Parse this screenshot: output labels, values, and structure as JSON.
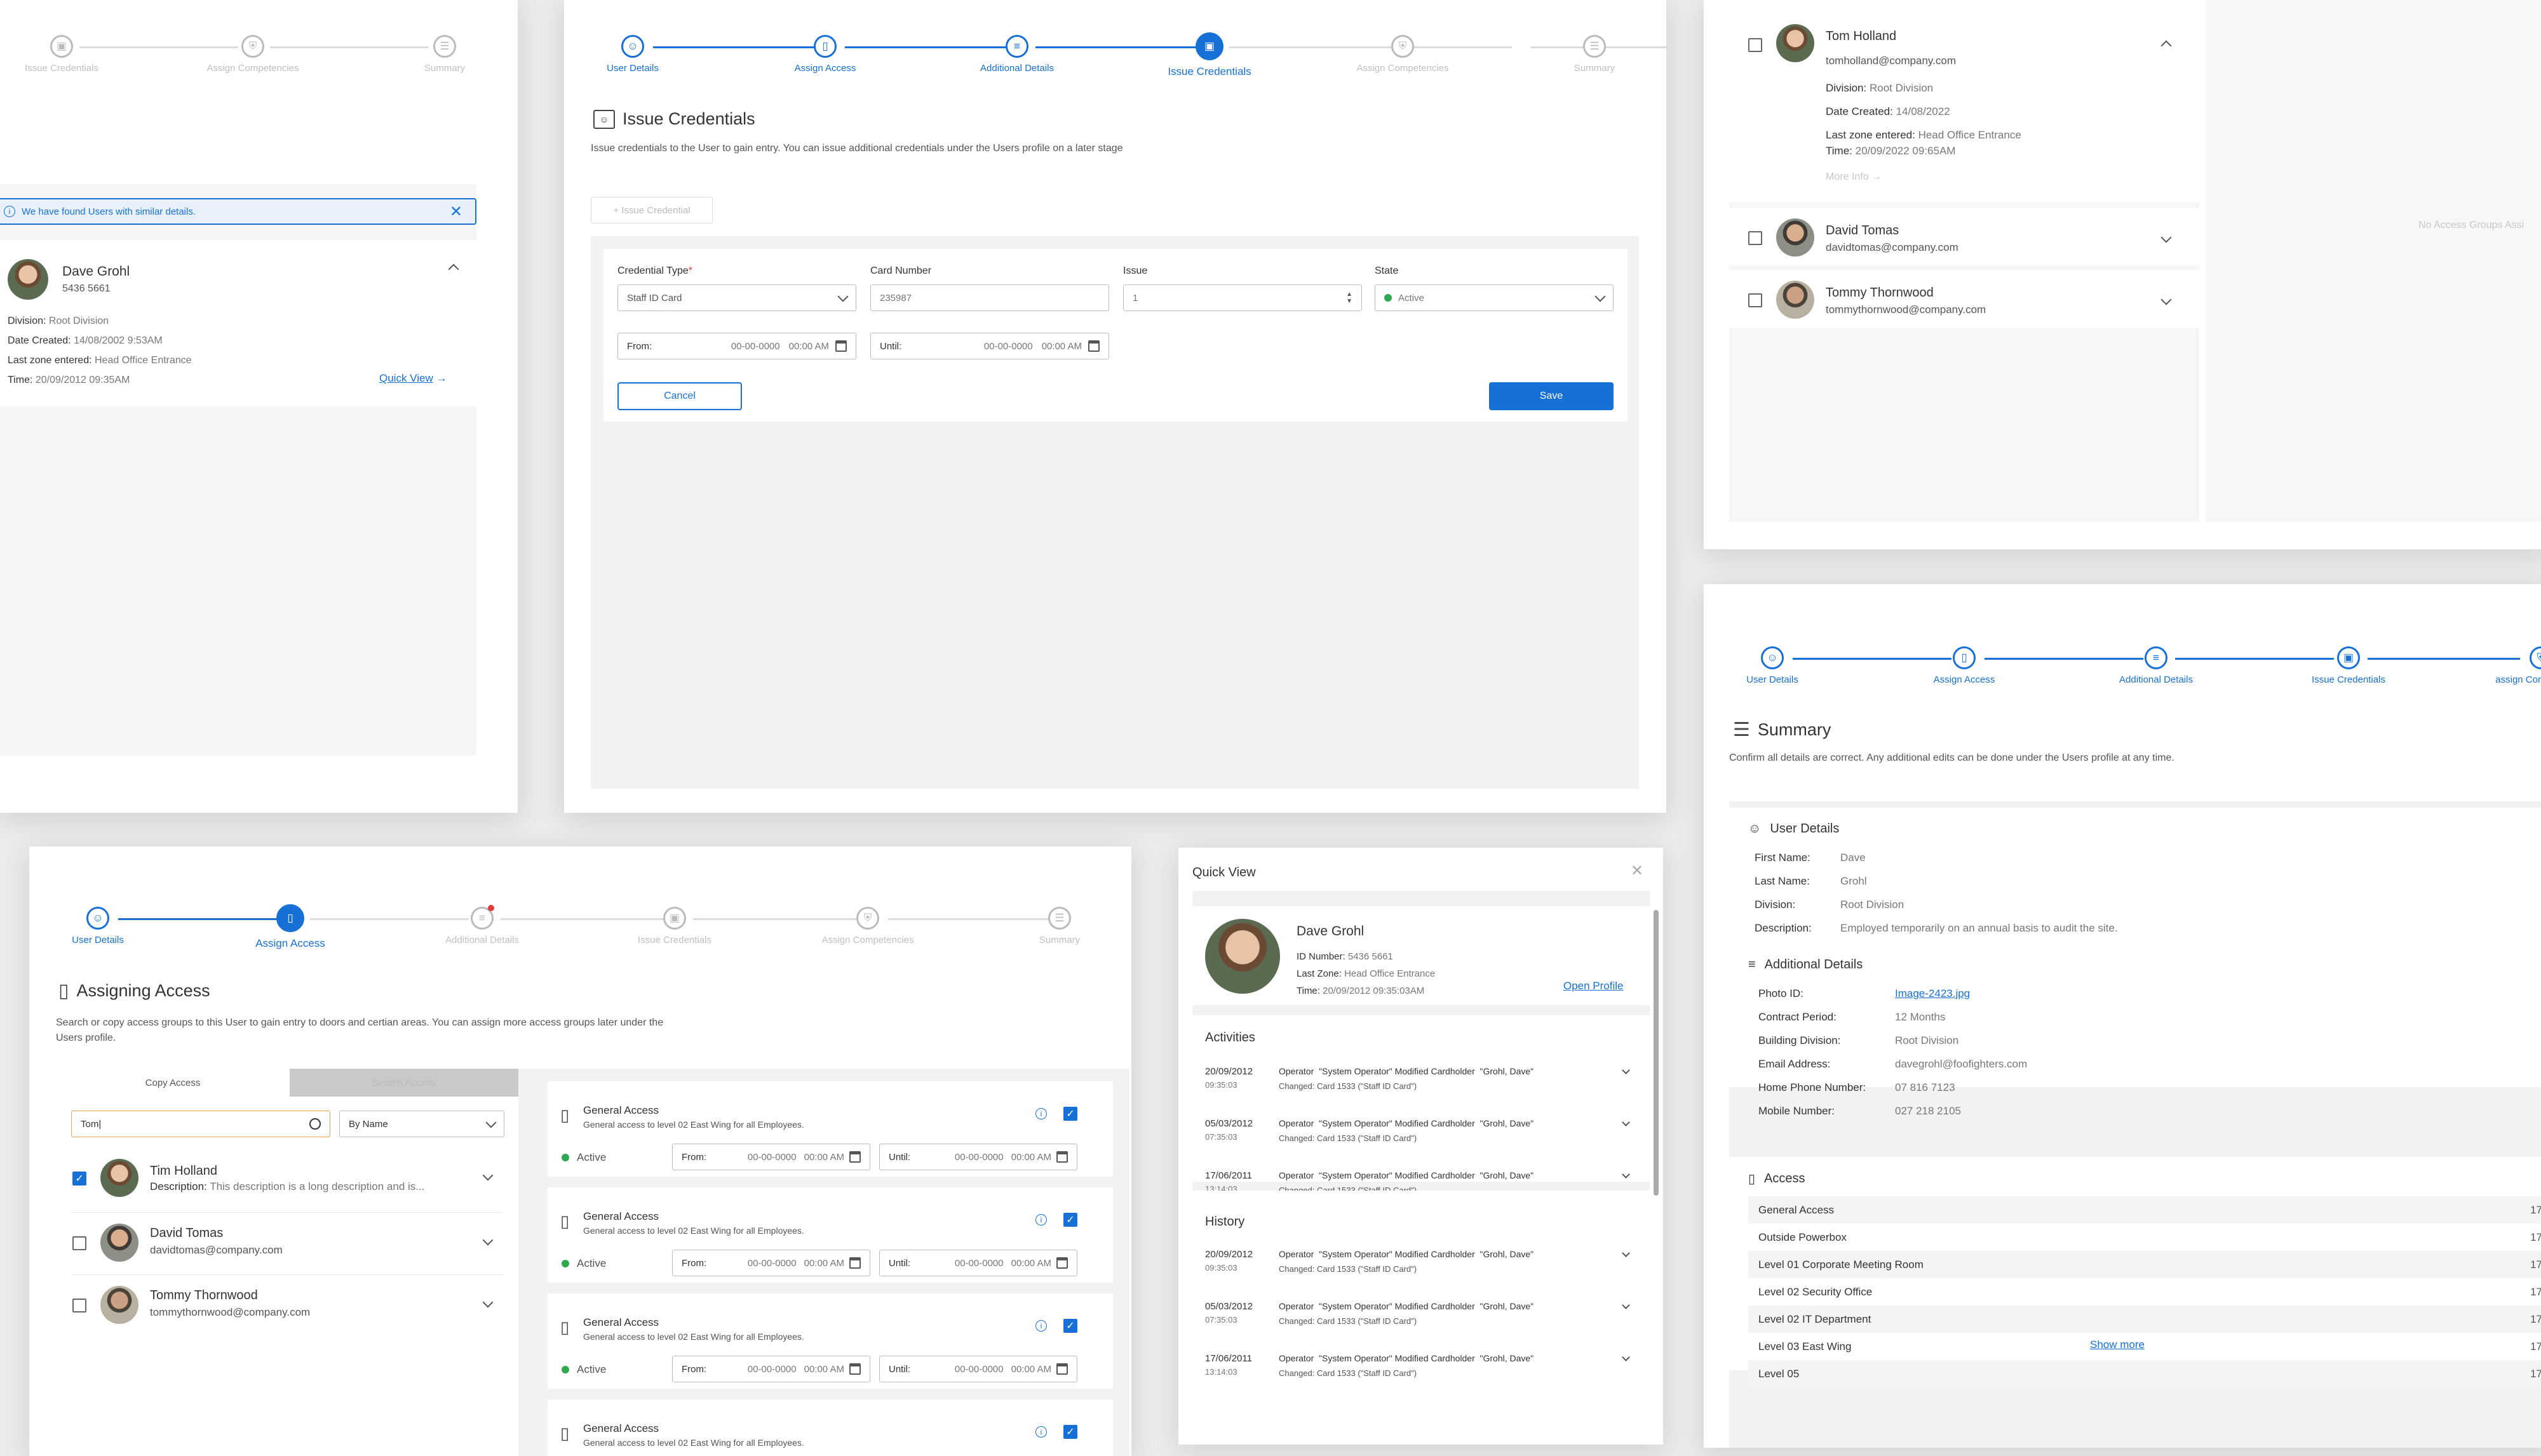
{
  "steps_full": [
    "User Details",
    "Assign Access",
    "Additional Details",
    "Issue Credentials",
    "Assign Competencies",
    "Summary"
  ],
  "steps_short": [
    "User Details",
    "Assign Access",
    "Additional Details",
    "Issue Credentials",
    "assign Competencies"
  ],
  "panel_a": {
    "steps": [
      "Issue Credentials",
      "Assign Competencies",
      "Summary"
    ],
    "alert": "We have found Users with similar details.",
    "user": {
      "name": "Dave Grohl",
      "id": "5436 5661"
    },
    "details": [
      {
        "k": "Division:",
        "v": "Root Division"
      },
      {
        "k": "Date Created:",
        "v": "14/08/2002 9:53AM"
      },
      {
        "k": "Last zone entered:",
        "v": "Head Office Entrance"
      },
      {
        "k": "Time:",
        "v": "20/09/2012 09:35AM"
      }
    ],
    "quick_view": "Quick View"
  },
  "panel_b": {
    "title": "Issue Credentials",
    "desc": "Issue credentials to the User to gain entry. You can issue additional credentials under the Users profile on a later stage",
    "issue_btn": "+ Issue Credential",
    "labels": {
      "type": "Credential Type",
      "card": "Card Number",
      "issue": "Issue",
      "state": "State",
      "from": "From:",
      "until": "Until:"
    },
    "values": {
      "type": "Staff ID Card",
      "card": "235987",
      "issue": "1",
      "state": "Active",
      "date": "00-00-0000",
      "time": "00:00 AM"
    },
    "cancel": "Cancel",
    "save": "Save"
  },
  "panel_c": {
    "users": [
      {
        "name": "Tom Holland",
        "email": "tomholland@company.com",
        "division_k": "Division:",
        "division": "Root Division",
        "created_k": "Date Created:",
        "created": "14/08/2022",
        "zone_k": "Last zone entered:",
        "zone": "Head Office Entrance",
        "time_k": "Time:",
        "time": "20/09/2022 09:65AM",
        "more": "More Info"
      },
      {
        "name": "David Tomas",
        "email": "davidtomas@company.com"
      },
      {
        "name": "Tommy Thornwood",
        "email": "tommythornwood@company.com"
      }
    ],
    "empty": "No Access Groups Assi"
  },
  "panel_d": {
    "title": "Summary",
    "desc": "Confirm all details are correct. Any additional edits can be done under the Users profile at any time.",
    "user_details_title": "User Details",
    "user_details": [
      {
        "k": "First Name:",
        "v": "Dave"
      },
      {
        "k": "Last Name:",
        "v": "Grohl"
      },
      {
        "k": "Division:",
        "v": "Root Division"
      },
      {
        "k": "Description:",
        "v": "Employed temporarily on an annual basis to audit the site."
      }
    ],
    "additional_title": "Additional Details",
    "additional": [
      {
        "k": "Photo ID:",
        "v": "Image-2423.jpg"
      },
      {
        "k": "Contract Period:",
        "v": "12 Months"
      },
      {
        "k": "Building Division:",
        "v": "Root Division"
      },
      {
        "k": "Email Address:",
        "v": "davegrohl@foofighters.com"
      },
      {
        "k": "Home Phone Number:",
        "v": "07 816 7123"
      },
      {
        "k": "Mobile Number:",
        "v": "027 218 2105"
      }
    ],
    "access_title": "Access",
    "access": [
      "General Access",
      "Outside Powerbox",
      "Level 01 Corporate Meeting Room",
      "Level 02 Security Office",
      "Level 02 IT Department",
      "Level 03 East Wing",
      "Level 05"
    ],
    "access_val": "17",
    "show_more": "Show more"
  },
  "panel_e": {
    "title": "Assigning Access",
    "desc": "Search or copy access groups to this User to gain entry to doors and certian areas. You can assign more access groups later under the Users profile.",
    "tabs": [
      "Copy Access",
      "Search Access"
    ],
    "search_value": "Tom|",
    "filter": "By Name",
    "users": [
      {
        "name": "Tim Holland",
        "sub_k": "Description:",
        "sub": "This description is a long description and is..."
      },
      {
        "name": "David Tomas",
        "sub": "davidtomas@company.com"
      },
      {
        "name": "Tommy Thornwood",
        "sub": "tommythornwood@company.com"
      }
    ],
    "group": {
      "title": "General Access",
      "desc": "General access to level 02 East Wing for all Employees.",
      "state": "Active",
      "from": "From:",
      "until": "Until:",
      "date": "00-00-0000",
      "time": "00:00 AM"
    }
  },
  "panel_f": {
    "title": "Quick View",
    "name": "Dave Grohl",
    "id_k": "ID Number:",
    "id": "5436 5661",
    "zone_k": "Last Zone:",
    "zone": "Head Office Entrance",
    "time_k": "Time:",
    "time": "20/09/2012 09:35:03AM",
    "open_profile": "Open Profile",
    "activities_title": "Activities",
    "history_title": "History",
    "entries": [
      {
        "date": "20/09/2012",
        "time": "09:35:03"
      },
      {
        "date": "05/03/2012",
        "time": "07:35:03"
      },
      {
        "date": "17/06/2011",
        "time": "13:14:03"
      }
    ],
    "entry_main": "Operator  \"System Operator\" Modified Cardholder  \"Grohl, Dave\"",
    "entry_sub": "Changed: Card 1533 (\"Staff ID Card\")"
  },
  "colors": {
    "accent": "#1670d6",
    "active": "#2fa84f",
    "alert": "#e23b3b"
  }
}
